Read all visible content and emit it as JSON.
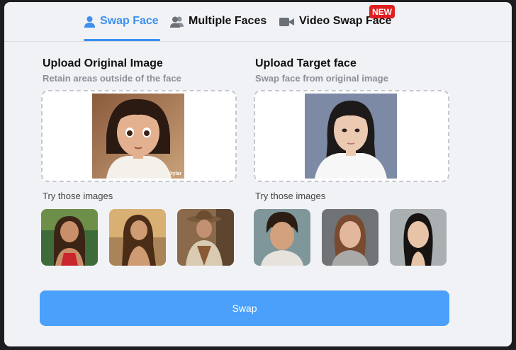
{
  "tabs": [
    {
      "label": "Swap Face",
      "icon": "user-icon",
      "active": true
    },
    {
      "label": "Multiple Faces",
      "icon": "users-icon",
      "active": false
    },
    {
      "label": "Video Swap Face",
      "icon": "video-camera-icon",
      "active": false,
      "badge": "NEW"
    }
  ],
  "original": {
    "title": "Upload Original Image",
    "subtitle": "Retain areas outside of the face",
    "watermark": "Stylar",
    "try_label": "Try those images",
    "samples": [
      "woman-beach",
      "woman-sunset",
      "cowboy"
    ]
  },
  "target": {
    "title": "Upload Target face",
    "subtitle": "Swap face from original image",
    "try_label": "Try those images",
    "samples": [
      "man-curly-hair",
      "woman-freckles",
      "woman-asian"
    ]
  },
  "swap_button": "Swap",
  "colors": {
    "accent": "#3b8ff0",
    "button": "#4aa0fa",
    "badge": "#e02020"
  }
}
